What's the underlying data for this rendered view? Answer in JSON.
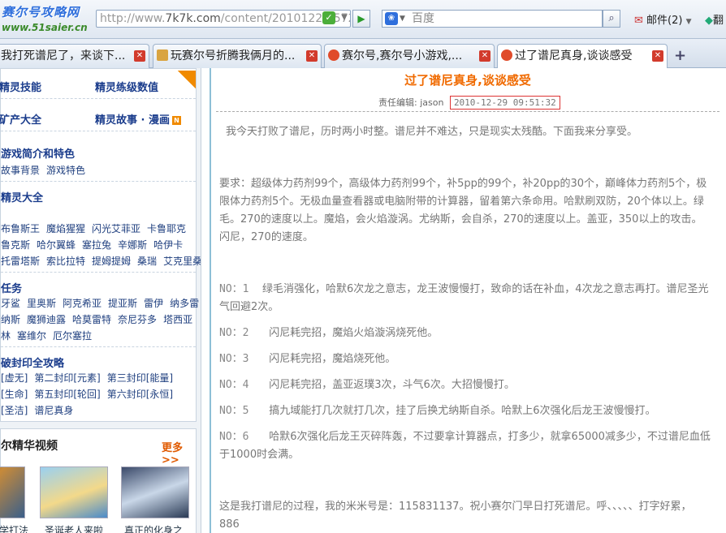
{
  "toolbar": {
    "logo_line1": "赛尔号攻略网",
    "logo_line2": "www.51saier.cn",
    "url_prefix": "http://www.",
    "url_main": "7k7k.com",
    "url_rest": "/content/20101229/5728",
    "search_placeholder": "百度",
    "mail_label": "邮件(2)",
    "extra_label": "翻"
  },
  "tabs": [
    {
      "label": "我打死谱尼了，来谈下..."
    },
    {
      "label": "玩赛尔号折腾我俩月的..."
    },
    {
      "label": "赛尔号,赛尔号小游戏,..."
    },
    {
      "label": "过了谱尼真身,谈谈感受"
    }
  ],
  "sidebar": {
    "top_links": [
      {
        "label": "精灵技能"
      },
      {
        "label": "精灵练级数值"
      },
      {
        "label": "矿产大全"
      },
      {
        "label": "精灵故事 · 漫画"
      }
    ],
    "section_intro": {
      "title": "游戏简介和特色",
      "links": [
        "故事背景",
        "游戏特色"
      ]
    },
    "section_spirits": {
      "title": "精灵大全",
      "rows": [
        [
          "布鲁斯王",
          "魔焰猩猩",
          "闪光艾菲亚",
          "卡鲁耶克"
        ],
        [
          "鲁克斯",
          "哈尔翼蜂",
          "塞拉兔",
          "辛娜斯",
          "哈伊卡"
        ],
        [
          "托雷塔斯",
          "索比拉特",
          "提姆提姆",
          "桑瑞",
          "艾克里桑"
        ]
      ]
    },
    "section_tasks": {
      "title": "任务",
      "rows": [
        [
          "牙鲨",
          "里奥斯",
          "阿克希亚",
          "提亚斯",
          "雷伊",
          "纳多雷"
        ],
        [
          "纳斯",
          "魔狮迪露",
          "哈莫雷特",
          "奈尼芬多",
          "塔西亚"
        ],
        [
          "林",
          "塞维尔",
          "厄尔塞拉"
        ]
      ]
    },
    "section_seal": {
      "title": "破封印全攻略",
      "rows": [
        [
          "[虚无]",
          "第二封印[元素]",
          "第三封印[能量]"
        ],
        [
          "[生命]",
          "第五封印[轮回]",
          "第六封印[永恒]"
        ],
        [
          "[圣洁]",
          "谱尼真身"
        ]
      ]
    },
    "video": {
      "title": "尔精华视频",
      "more_label": "更多>>",
      "captions": [
        "学打法",
        "圣诞老人来啦",
        "真正的化身之"
      ]
    }
  },
  "article": {
    "title": "过了谱尼真身,谈谈感受",
    "editor_label": "责任编辑: jason",
    "date": "2010-12-29 09:51:32",
    "paragraphs": [
      "我今天打败了谱尼，历时两小时整。谱尼并不难达，只是现实太残酷。下面我来分享受。",
      "要求：超级体力药剂99个，高级体力药剂99个，补5pp的99个，补20pp的30个，巅峰体力药剂5个，极限体力药剂5个。无极血量查看器或电脑附带的计算器，留着第六条命用。哈默刷双防，20个体以上。绿毛。270的速度以上。魔焰，会火焰漩涡。尤纳斯，会自杀，270的速度以上。盖亚，350以上的攻击。闪尼，270的速度。"
    ],
    "steps": [
      {
        "no": "NO：1",
        "text": "绿毛消强化，哈默6次龙之意志，龙王波慢慢打，致命的话在补血，4次龙之意志再打。谱尼圣光气回避2次。"
      },
      {
        "no": "NO：2",
        "text": "闪尼耗完招，魔焰火焰漩涡烧死他。"
      },
      {
        "no": "NO：3",
        "text": "闪尼耗完招，魔焰烧死他。"
      },
      {
        "no": "NO：4",
        "text": "闪尼耗完招，盖亚返璞3次，斗气6次。大招慢慢打。"
      },
      {
        "no": "NO：5",
        "text": "搞九域能打几次就打几次，挂了后换尤纳斯自杀。哈默上6次强化后龙王波慢慢打。"
      },
      {
        "no": "NO：6",
        "text": "哈默6次强化后龙王灭碎阵轰，不过要拿计算器点，打多少，就拿65000减多少，不过谱尼血低于1000时会满。"
      }
    ],
    "closing": "这是我打谱尼的过程，我的米米号是：115831137。祝小赛尔门早日打死谱尼。呼、、、、、打字好累，886"
  }
}
